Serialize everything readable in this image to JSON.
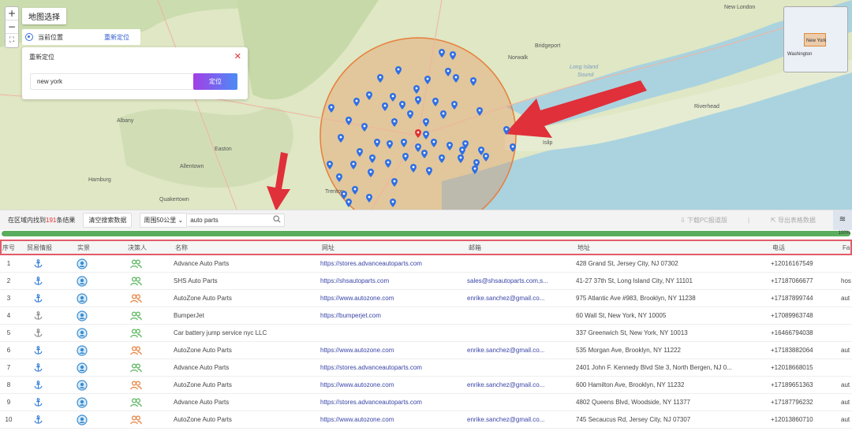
{
  "map": {
    "zoom_in": "+",
    "zoom_out": "−",
    "fullscreen": "⛶",
    "select_label": "地图选择",
    "current_position": "当前位置",
    "relocate_link": "重新定位",
    "panel": {
      "title": "重新定位",
      "close": "✕",
      "input_value": "new york",
      "locate_button": "定位"
    },
    "minimap": {
      "label1": "New York",
      "label2": "Washington"
    },
    "labels": [
      "Bridgeport",
      "Long Island",
      "Sound",
      "Norwalk",
      "New London",
      "Easton",
      "Allentown",
      "Hamburg",
      "Quakertown",
      "Riverhead",
      "Islip",
      "Albany",
      "Trenton"
    ],
    "colors": {
      "circle": "#e87e3a",
      "pin": "#2f6fe6",
      "center_pin": "#e0302f",
      "arrow": "#e0303a"
    }
  },
  "toolbar": {
    "found_prefix": "在区域内找到",
    "found_count": "191",
    "found_suffix": "条结果",
    "clear_button": "清空搜索数据",
    "range_select": "周围50公里 ⌄",
    "keyword": "auto parts",
    "download": "下载PC报道版",
    "separator": "|",
    "export": "导出表格数据",
    "collapse": "≋"
  },
  "progress": {
    "value": 1.0,
    "label": "100%"
  },
  "table": {
    "headers": {
      "no": "序号",
      "trade": "贸易情报",
      "real": "实景",
      "decision": "决策人",
      "name": "名称",
      "website": "网址",
      "email": "邮箱",
      "address": "地址",
      "phone": "电话",
      "fa": "Fa"
    },
    "rows": [
      {
        "no": "1",
        "name": "Advance Auto Parts",
        "website": "https://stores.advanceautoparts.com",
        "email": "",
        "address": "428 Grand St, Jersey City, NJ 07302",
        "phone": "+12016167549",
        "fa": "",
        "trade_color": "#2f7ad8",
        "dec_color": "#56b35a"
      },
      {
        "no": "2",
        "name": "SHS Auto Parts",
        "website": "https://shsautoparts.com",
        "email": "sales@shsautoparts.com,s...",
        "address": "41-27 37th St, Long Island City, NY 11101",
        "phone": "+17187066677",
        "fa": "hos",
        "trade_color": "#2f7ad8",
        "dec_color": "#56b35a"
      },
      {
        "no": "3",
        "name": "AutoZone Auto Parts",
        "website": "https://www.autozone.com",
        "email": "enrike.sanchez@gmail.co...",
        "address": "975 Atlantic Ave #983, Brooklyn, NY 11238",
        "phone": "+17187899744",
        "fa": "aut",
        "trade_color": "#2f7ad8",
        "dec_color": "#e87e3a"
      },
      {
        "no": "4",
        "name": "BumperJet",
        "website": "https://bumperjet.com",
        "email": "",
        "address": "60 Wall St, New York, NY 10005",
        "phone": "+17089963748",
        "fa": "",
        "trade_color": "#888888",
        "dec_color": "#56b35a"
      },
      {
        "no": "5",
        "name": "Car battery jump service nyc LLC",
        "website": "",
        "email": "",
        "address": "337 Greenwich St, New York, NY 10013",
        "phone": "+16466794038",
        "fa": "",
        "trade_color": "#888888",
        "dec_color": "#56b35a"
      },
      {
        "no": "6",
        "name": "AutoZone Auto Parts",
        "website": "https://www.autozone.com",
        "email": "enrike.sanchez@gmail.co...",
        "address": "535 Morgan Ave, Brooklyn, NY 11222",
        "phone": "+17183882064",
        "fa": "aut",
        "trade_color": "#2f7ad8",
        "dec_color": "#e87e3a"
      },
      {
        "no": "7",
        "name": "Advance Auto Parts",
        "website": "https://stores.advanceautoparts.com",
        "email": "",
        "address": "2401 John F. Kennedy Blvd Ste 3, North Bergen, NJ 0...",
        "phone": "+12018668015",
        "fa": "",
        "trade_color": "#2f7ad8",
        "dec_color": "#56b35a"
      },
      {
        "no": "8",
        "name": "AutoZone Auto Parts",
        "website": "https://www.autozone.com",
        "email": "enrike.sanchez@gmail.co...",
        "address": "600 Hamilton Ave, Brooklyn, NY 11232",
        "phone": "+17189651363",
        "fa": "aut",
        "trade_color": "#2f7ad8",
        "dec_color": "#e87e3a"
      },
      {
        "no": "9",
        "name": "Advance Auto Parts",
        "website": "https://stores.advanceautoparts.com",
        "email": "",
        "address": "4802 Queens Blvd, Woodside, NY 11377",
        "phone": "+17187796232",
        "fa": "aut",
        "trade_color": "#2f7ad8",
        "dec_color": "#56b35a"
      },
      {
        "no": "10",
        "name": "AutoZone Auto Parts",
        "website": "https://www.autozone.com",
        "email": "enrike.sanchez@gmail.co...",
        "address": "745 Secaucus Rd, Jersey City, NJ 07307",
        "phone": "+12013860710",
        "fa": "aut",
        "trade_color": "#2f7ad8",
        "dec_color": "#e87e3a"
      }
    ]
  }
}
